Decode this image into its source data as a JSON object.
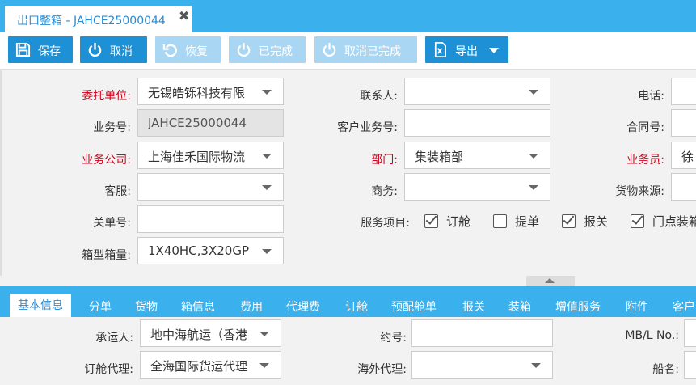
{
  "tab": {
    "title": "出口整箱 - JAHCE25000044",
    "close": "✖"
  },
  "toolbar": {
    "save": "保存",
    "cancel": "取消",
    "restore": "恢复",
    "completed": "已完成",
    "cancel_completed": "取消已完成",
    "export": "导出"
  },
  "form": {
    "client_label": "委托单位:",
    "client_value": "无锡皓铄科技有限",
    "contact_label": "联系人:",
    "contact_value": "",
    "phone_label": "电话:",
    "business_no_label": "业务号:",
    "business_no_value": "JAHCE25000044",
    "customer_business_no_label": "客户业务号:",
    "customer_business_no_value": "",
    "contract_no_label": "合同号:",
    "business_company_label": "业务公司:",
    "business_company_value": "上海佳禾国际物流",
    "department_label": "部门:",
    "department_value": "集装箱部",
    "salesman_label": "业务员:",
    "salesman_value": "徐",
    "customer_service_label": "客服:",
    "commerce_label": "商务:",
    "cargo_source_label": "货物来源:",
    "customs_no_label": "关单号:",
    "customs_no_value": "",
    "service_items_label": "服务项目:",
    "service_items": [
      {
        "label": "订舱",
        "checked": true
      },
      {
        "label": "提单",
        "checked": false
      },
      {
        "label": "报关",
        "checked": true
      },
      {
        "label": "门点装箱",
        "checked": true
      }
    ],
    "container_label": "箱型箱量:",
    "container_value": "1X40HC,3X20GP"
  },
  "subtabs": [
    "基本信息",
    "分单",
    "货物",
    "箱信息",
    "费用",
    "代理费",
    "订舱",
    "预配舱单",
    "报关",
    "装箱",
    "增值服务",
    "附件",
    "客户"
  ],
  "lower": {
    "carrier_label": "承运人:",
    "carrier_value": "地中海航运（香港",
    "contract_label": "约号:",
    "mbl_label": "MB/L No.:",
    "booking_agent_label": "订舱代理:",
    "booking_agent_value": "全海国际货运代理",
    "overseas_agent_label": "海外代理:",
    "vessel_label": "船名:"
  }
}
